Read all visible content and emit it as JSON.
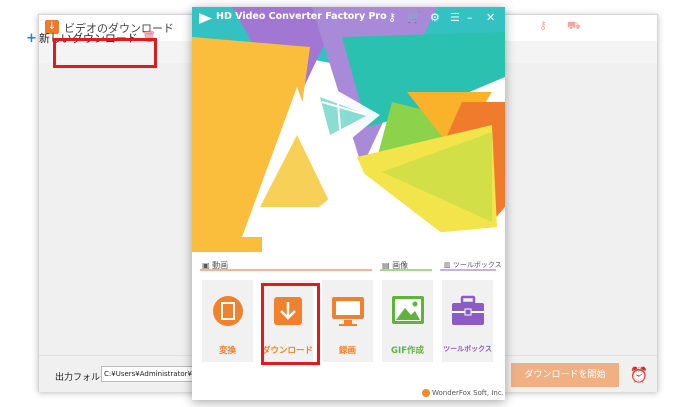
{
  "bg_window": {
    "title": "ビデオのダウンロード",
    "new_download_label": "新しいダウンロード",
    "output_folder_label": "出力フォルダ：",
    "output_folder_path": "C:¥Users¥Administrator¥Videos",
    "download_all_label": "ダウンロードを開始"
  },
  "main_window": {
    "title": "HD Video Converter Factory Pro",
    "sections": {
      "video": "動画",
      "image": "画像",
      "tools": "ツールボックス"
    },
    "tiles": [
      {
        "label": "変換",
        "icon": "convert-icon",
        "color": "#f0822f"
      },
      {
        "label": "ダウンロード",
        "icon": "download-icon",
        "color": "#f0822f"
      },
      {
        "label": "録画",
        "icon": "screen-record-icon",
        "color": "#f0822f"
      },
      {
        "label": "GIF作成",
        "icon": "gif-maker-icon",
        "color": "#5cb53a"
      },
      {
        "label": "ツールボックス",
        "icon": "toolbox-icon",
        "color": "#8a5cc4"
      }
    ],
    "footer": "WonderFox Soft, Inc."
  },
  "colors": {
    "orange": "#f0822f",
    "green": "#5cb53a",
    "purple": "#8a5cc4",
    "highlight_red": "#e01b1b",
    "teal": "#27c0b3"
  }
}
